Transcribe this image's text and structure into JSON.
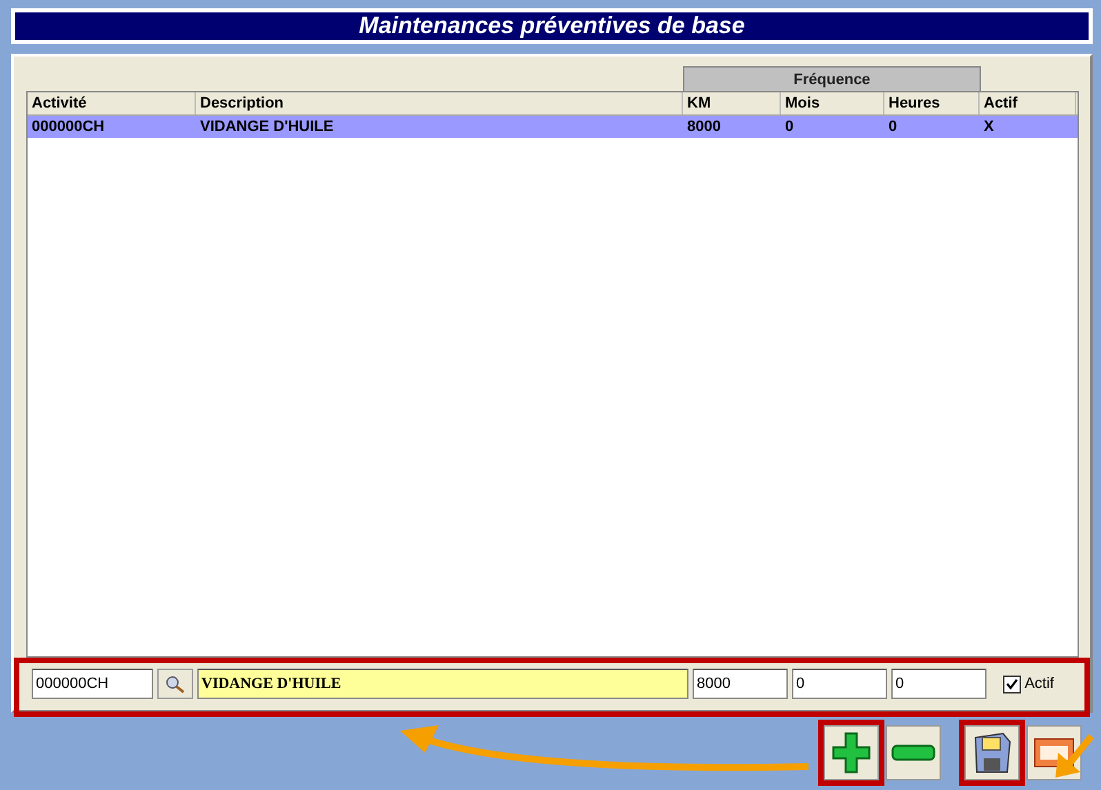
{
  "window": {
    "title": "Maintenances préventives de base"
  },
  "table": {
    "group_header": "Fréquence",
    "columns": [
      "Activité",
      "Description",
      "KM",
      "Mois",
      "Heures",
      "Actif"
    ],
    "rows": [
      {
        "cells": [
          "000000CH",
          "VIDANGE D'HUILE",
          "8000",
          "0",
          "0",
          "X"
        ],
        "selected": true
      }
    ]
  },
  "editor": {
    "activity": "000000CH",
    "description": "VIDANGE D'HUILE",
    "km": "8000",
    "mois": "0",
    "heures": "0",
    "actif_label": "Actif",
    "actif_checked": true
  },
  "buttons": [
    {
      "kind": "add",
      "highlighted": true
    },
    {
      "kind": "remove",
      "highlighted": false
    },
    {
      "kind": "save",
      "highlighted": true
    },
    {
      "kind": "exit",
      "highlighted": false
    }
  ]
}
